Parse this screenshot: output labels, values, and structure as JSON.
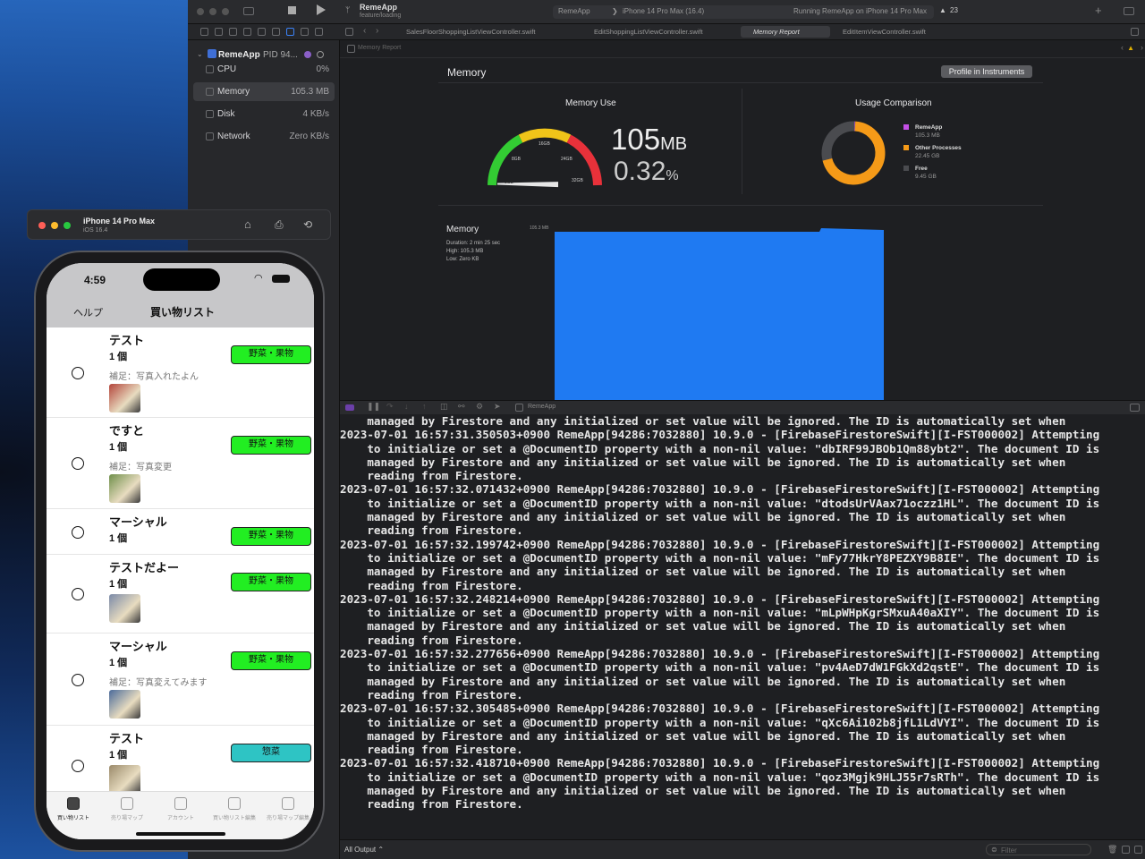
{
  "xcode": {
    "app": {
      "name": "RemeApp",
      "branch": "feature/loading"
    },
    "breadcrumb": {
      "scheme": "RemeApp",
      "device": "iPhone 14 Pro Max (16.4)"
    },
    "status": "Running RemeApp on iPhone 14 Pro Max",
    "warnings": "23",
    "tabs": [
      "SalesFloorShoppingListViewController.swift",
      "EditShoppingListViewController.swift",
      "Memory Report",
      "EditItemViewController.swift"
    ],
    "jump": "Memory Report",
    "process": {
      "name": "RemeApp",
      "pid": "PID 94..."
    },
    "gauges": [
      {
        "label": "CPU",
        "value": "0%"
      },
      {
        "label": "Memory",
        "value": "105.3 MB"
      },
      {
        "label": "Disk",
        "value": "4 KB/s"
      },
      {
        "label": "Network",
        "value": "Zero KB/s"
      }
    ],
    "report": {
      "title": "Memory",
      "profile_button": "Profile in Instruments",
      "memory_use_title": "Memory Use",
      "value_mb": "105",
      "unit_mb": "MB",
      "value_pct": "0.32",
      "unit_pct": "%",
      "gauge_ticks": [
        "0GB",
        "8GB",
        "16GB",
        "24GB",
        "32GB"
      ],
      "gauge_fraction": 0.0032,
      "usage_title": "Usage Comparison",
      "usage": [
        {
          "name": "RemeApp",
          "value": "105.3 MB",
          "gb": 0.1053,
          "color": "#c44fe6"
        },
        {
          "name": "Other Processes",
          "value": "22.45 GB",
          "gb": 22.45,
          "color": "#f59a18"
        },
        {
          "name": "Free",
          "value": "9.45 GB",
          "gb": 9.45,
          "color": "#4a4b4f"
        }
      ],
      "timeline_title": "Memory",
      "duration": "Duration: 2 min 25 sec",
      "high": "High: 105.3 MB",
      "low": "Low: Zero KB",
      "timeline_tick": "105.3 MB"
    },
    "console_target": "RemeApp",
    "console_lines": [
      "    managed by Firestore and any initialized or set value will be ignored. The ID is automatically set when",
      "2023-07-01 16:57:31.350503+0900 RemeApp[94286:7032880] 10.9.0 - [FirebaseFirestoreSwift][I-FST000002] Attempting",
      "    to initialize or set a @DocumentID property with a non-nil value: \"dbIRF99JBOb1Qm88ybt2\". The document ID is",
      "    managed by Firestore and any initialized or set value will be ignored. The ID is automatically set when",
      "    reading from Firestore.",
      "2023-07-01 16:57:32.071432+0900 RemeApp[94286:7032880] 10.9.0 - [FirebaseFirestoreSwift][I-FST000002] Attempting",
      "    to initialize or set a @DocumentID property with a non-nil value: \"dtodsUrVAax71oczz1HL\". The document ID is",
      "    managed by Firestore and any initialized or set value will be ignored. The ID is automatically set when",
      "    reading from Firestore.",
      "2023-07-01 16:57:32.199742+0900 RemeApp[94286:7032880] 10.9.0 - [FirebaseFirestoreSwift][I-FST000002] Attempting",
      "    to initialize or set a @DocumentID property with a non-nil value: \"mFy77HkrY8PEZXY9B8IE\". The document ID is",
      "    managed by Firestore and any initialized or set value will be ignored. The ID is automatically set when",
      "    reading from Firestore.",
      "2023-07-01 16:57:32.248214+0900 RemeApp[94286:7032880] 10.9.0 - [FirebaseFirestoreSwift][I-FST000002] Attempting",
      "    to initialize or set a @DocumentID property with a non-nil value: \"mLpWHpKgrSMxuA40aXIY\". The document ID is",
      "    managed by Firestore and any initialized or set value will be ignored. The ID is automatically set when",
      "    reading from Firestore.",
      "2023-07-01 16:57:32.277656+0900 RemeApp[94286:7032880] 10.9.0 - [FirebaseFirestoreSwift][I-FST000002] Attempting",
      "    to initialize or set a @DocumentID property with a non-nil value: \"pv4AeD7dW1FGkXd2qstE\". The document ID is",
      "    managed by Firestore and any initialized or set value will be ignored. The ID is automatically set when",
      "    reading from Firestore.",
      "2023-07-01 16:57:32.305485+0900 RemeApp[94286:7032880] 10.9.0 - [FirebaseFirestoreSwift][I-FST000002] Attempting",
      "    to initialize or set a @DocumentID property with a non-nil value: \"qXc6Ai102b8jfL1LdVYI\". The document ID is",
      "    managed by Firestore and any initialized or set value will be ignored. The ID is automatically set when",
      "    reading from Firestore.",
      "2023-07-01 16:57:32.418710+0900 RemeApp[94286:7032880] 10.9.0 - [FirebaseFirestoreSwift][I-FST000002] Attempting",
      "    to initialize or set a @DocumentID property with a non-nil value: \"qoz3Mgjk9HLJ55r7sRTh\". The document ID is",
      "    managed by Firestore and any initialized or set value will be ignored. The ID is automatically set when",
      "    reading from Firestore."
    ],
    "output_filter": "All Output ⌃",
    "filter_placeholder": "Filter"
  },
  "simulator": {
    "device": "iPhone 14 Pro Max",
    "os": "iOS 16.4",
    "time": "4:59",
    "nav_left": "ヘルプ",
    "nav_title": "買い物リスト",
    "items": [
      {
        "name": "テスト",
        "qty": "1 個",
        "note": "補足：写真入れたよん",
        "category": "野菜・果物",
        "cat_color": "#22ee22",
        "photo": true
      },
      {
        "name": "ですと",
        "qty": "1 個",
        "note": "補足：写真変更",
        "category": "野菜・果物",
        "cat_color": "#22ee22",
        "photo": true
      },
      {
        "name": "マーシャル",
        "qty": "1 個",
        "note": "",
        "category": "野菜・果物",
        "cat_color": "#22ee22",
        "photo": false
      },
      {
        "name": "テストだよー",
        "qty": "1 個",
        "note": "",
        "category": "野菜・果物",
        "cat_color": "#22ee22",
        "photo": true
      },
      {
        "name": "マーシャル",
        "qty": "1 個",
        "note": "補足：写真変えてみます",
        "category": "野菜・果物",
        "cat_color": "#22ee22",
        "photo": true
      },
      {
        "name": "テスト",
        "qty": "1 個",
        "note": "",
        "category": "惣菜",
        "cat_color": "#2ec4c4",
        "photo": true
      }
    ],
    "tabs": [
      "買い物リスト",
      "売り場マップ",
      "アカウント",
      "買い物リスト編集",
      "売り場マップ編集"
    ]
  }
}
